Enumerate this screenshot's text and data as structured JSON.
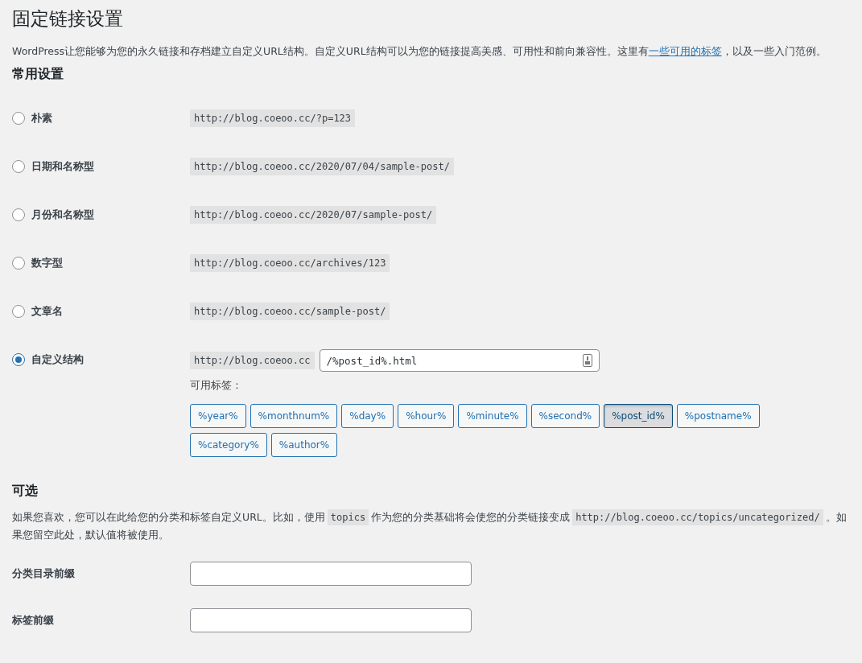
{
  "title": "固定链接设置",
  "intro": {
    "before": "WordPress让您能够为您的永久链接和存档建立自定义URL结构。自定义URL结构可以为您的链接提高美感、可用性和前向兼容性。这里有",
    "link": "一些可用的标签",
    "after": "，以及一些入门范例。"
  },
  "common_heading": "常用设置",
  "options": [
    {
      "label": "朴素",
      "example": "http://blog.coeoo.cc/?p=123",
      "selected": false,
      "kind": "preset"
    },
    {
      "label": "日期和名称型",
      "example": "http://blog.coeoo.cc/2020/07/04/sample-post/",
      "selected": false,
      "kind": "preset"
    },
    {
      "label": "月份和名称型",
      "example": "http://blog.coeoo.cc/2020/07/sample-post/",
      "selected": false,
      "kind": "preset"
    },
    {
      "label": "数字型",
      "example": "http://blog.coeoo.cc/archives/123",
      "selected": false,
      "kind": "preset"
    },
    {
      "label": "文章名",
      "example": "http://blog.coeoo.cc/sample-post/",
      "selected": false,
      "kind": "preset"
    },
    {
      "label": "自定义结构",
      "example": "http://blog.coeoo.cc",
      "value": "/%post_id%.html",
      "selected": true,
      "kind": "custom"
    }
  ],
  "tags_label": "可用标签：",
  "tags": [
    {
      "label": "%year%",
      "selected": false
    },
    {
      "label": "%monthnum%",
      "selected": false
    },
    {
      "label": "%day%",
      "selected": false
    },
    {
      "label": "%hour%",
      "selected": false
    },
    {
      "label": "%minute%",
      "selected": false
    },
    {
      "label": "%second%",
      "selected": false
    },
    {
      "label": "%post_id%",
      "selected": true
    },
    {
      "label": "%postname%",
      "selected": false
    },
    {
      "label": "%category%",
      "selected": false
    },
    {
      "label": "%author%",
      "selected": false
    }
  ],
  "optional_heading": "可选",
  "optional_text": [
    {
      "kind": "text",
      "text": "如果您喜欢，您可以在此给您的分类和标签自定义URL。比如，使用"
    },
    {
      "kind": "code",
      "text": "topics"
    },
    {
      "kind": "text",
      "text": "作为您的分类基础将会使您的分类链接变成"
    },
    {
      "kind": "code",
      "text": "http://blog.coeoo.cc/topics/uncategorized/"
    },
    {
      "kind": "text",
      "text": "。如果您留空此处，默认值将被使用。"
    }
  ],
  "fields": [
    {
      "label": "分类目录前缀"
    },
    {
      "label": "标签前缀"
    }
  ]
}
